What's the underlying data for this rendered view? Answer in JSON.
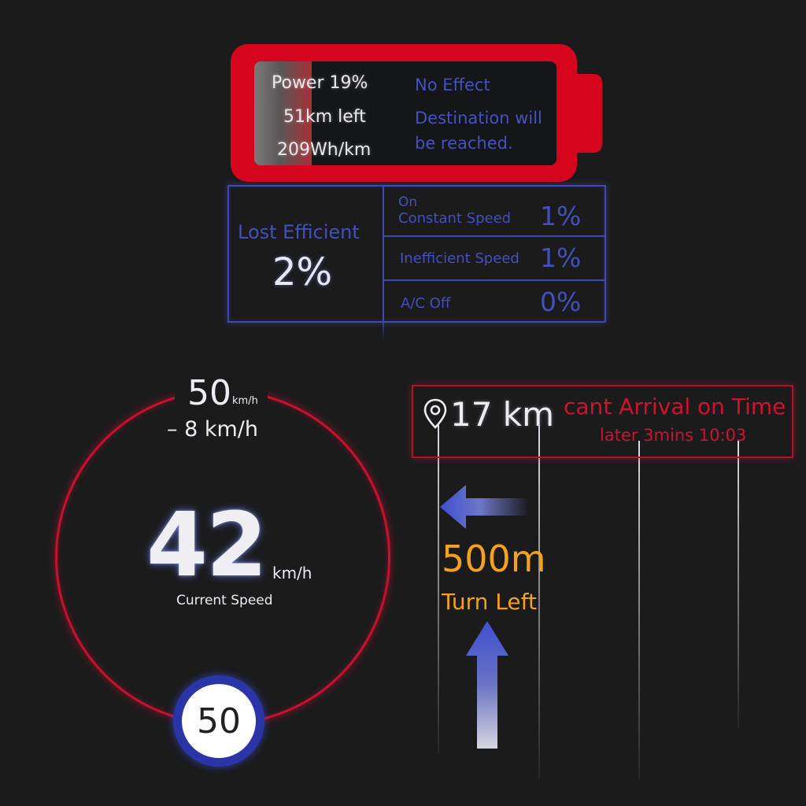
{
  "battery": {
    "power_label": "Power 19%",
    "range_label": "51km left",
    "consumption_label": "209Wh/km",
    "effect_label": "No Effect",
    "destination_line1": "Destination will",
    "destination_line2": "be reached.",
    "level_percent": 19,
    "color": "#d4051d"
  },
  "efficiency": {
    "title": "Lost Efficient",
    "total_value": "2%",
    "rows": [
      {
        "label_line1": "On",
        "label_line2": "Constant Speed",
        "value": "1%"
      },
      {
        "label_line1": "",
        "label_line2": "Inefficient Speed",
        "value": "1%"
      },
      {
        "label_line1": "",
        "label_line2": "A/C Off",
        "value": "0%"
      }
    ],
    "accent_color": "#3c4ab2"
  },
  "speed": {
    "target_value": "50",
    "target_unit": "km/h",
    "delta_label": "– 8 km/h",
    "current_value": "42",
    "current_unit": "km/h",
    "current_label": "Current Speed",
    "limit_sign_value": "50",
    "ring_color": "#c8102e"
  },
  "navigation": {
    "pin_icon": "location-pin-icon",
    "distance": "17 km",
    "warning_title": "cant Arrival on Time",
    "warning_detail": "later 3mins 10:03",
    "maneuver_distance": "500m",
    "maneuver_label": "Turn Left",
    "maneuver_icon": "arrow-left-icon",
    "straight_icon": "arrow-up-icon",
    "warning_color": "#d0112f",
    "maneuver_color": "#f4a11d"
  }
}
